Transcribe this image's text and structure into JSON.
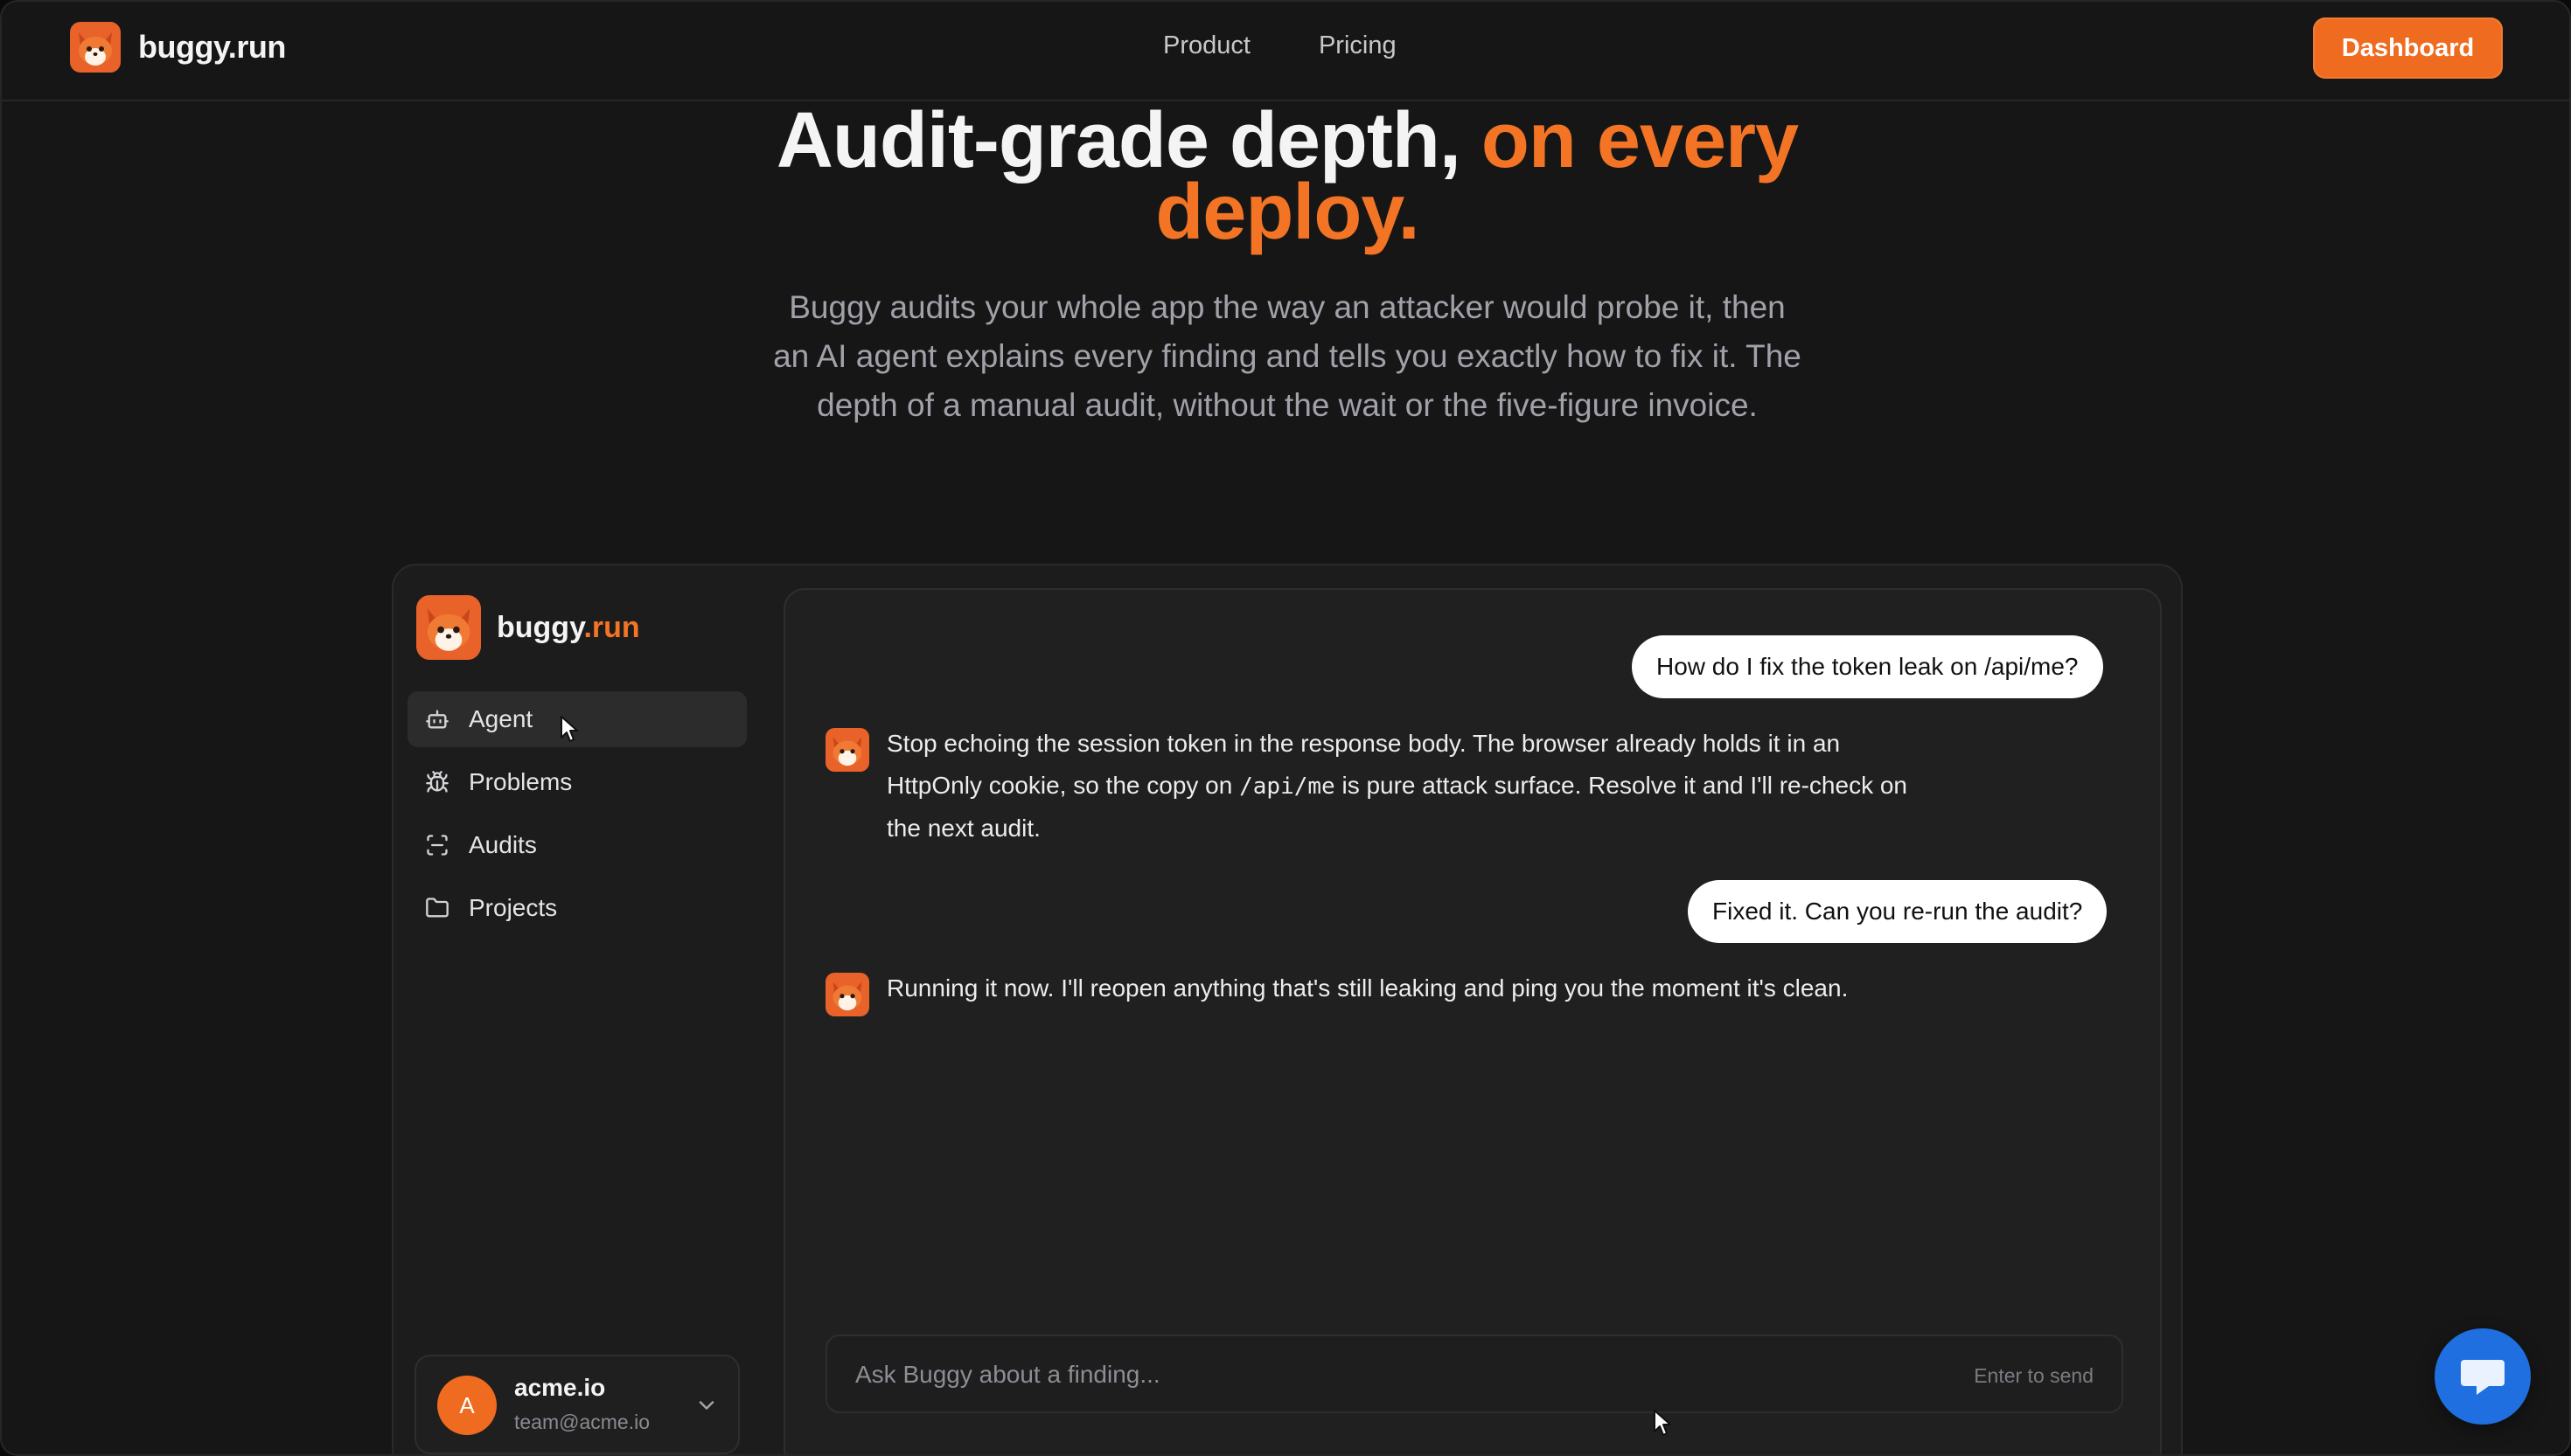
{
  "nav": {
    "brand": "buggy.run",
    "links": [
      "Product",
      "Pricing"
    ],
    "cta": "Dashboard"
  },
  "hero": {
    "title_plain": "Audit-grade depth, ",
    "title_accent_1": "on every",
    "title_accent_2": "deploy.",
    "subtitle": "Buggy audits your whole app the way an attacker would probe it, then an AI agent explains every finding and tells you exactly how to fix it. The depth of a manual audit, without the wait or the five-figure invoice."
  },
  "app": {
    "brand_main": "buggy",
    "brand_dot": ".run",
    "sidebar": {
      "items": [
        {
          "label": "Agent",
          "icon": "robot-icon",
          "active": true
        },
        {
          "label": "Problems",
          "icon": "bug-icon",
          "active": false
        },
        {
          "label": "Audits",
          "icon": "scan-icon",
          "active": false
        },
        {
          "label": "Projects",
          "icon": "folder-icon",
          "active": false
        }
      ]
    },
    "account": {
      "initial": "A",
      "name": "acme.io",
      "email": "team@acme.io"
    },
    "chat": {
      "messages": [
        {
          "role": "user",
          "text": "How do I fix the token leak on /api/me?"
        },
        {
          "role": "bot",
          "text_before": "Stop echoing the session token in the response body. The browser already holds it in an HttpOnly cookie, so the copy on ",
          "code": "/api/me",
          "text_after": " is pure attack surface. Resolve it and I'll re-check on the next audit."
        },
        {
          "role": "user",
          "text": "Fixed it. Can you re-run the audit?"
        },
        {
          "role": "bot",
          "text": "Running it now. I'll reopen anything that's still leaking and ping you the moment it's clean."
        }
      ],
      "input_placeholder": "Ask Buggy about a finding...",
      "input_hint": "Enter to send"
    }
  },
  "colors": {
    "accent": "#f27424",
    "button": "#ef6b1f",
    "chat_widget": "#1f6fe0",
    "background": "#161616"
  }
}
